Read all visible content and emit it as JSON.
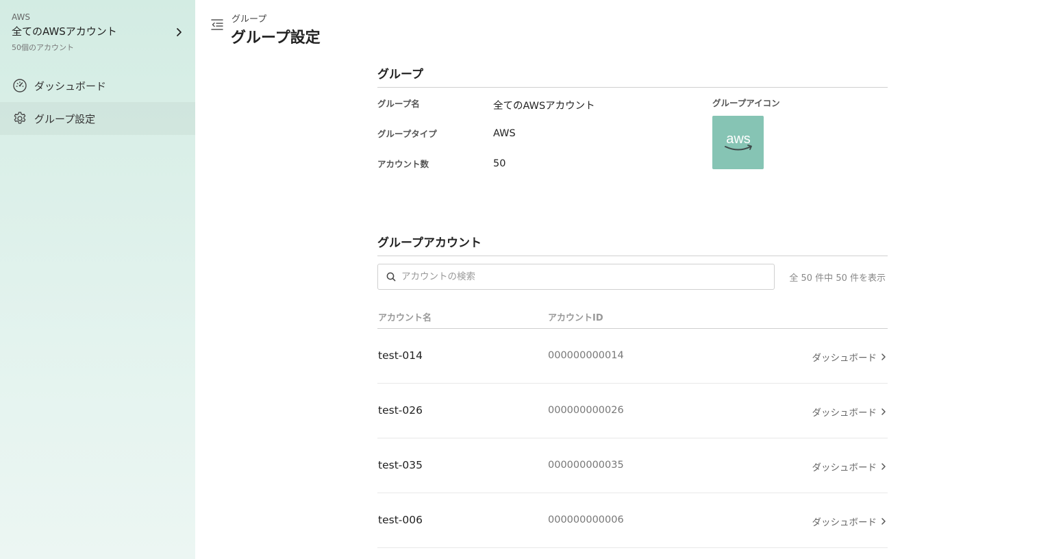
{
  "sidebar": {
    "org": {
      "provider": "AWS",
      "name": "全てのAWSアカウント",
      "count": "50個のアカウント"
    },
    "items": [
      {
        "label": "ダッシュボード",
        "icon": "gauge-icon",
        "active": false
      },
      {
        "label": "グループ設定",
        "icon": "gear-icon",
        "active": true
      }
    ]
  },
  "header": {
    "breadcrumb": "グループ",
    "title": "グループ設定"
  },
  "group": {
    "section_title": "グループ",
    "name_label": "グループ名",
    "name_value": "全てのAWSアカウント",
    "type_label": "グループタイプ",
    "type_value": "AWS",
    "count_label": "アカウント数",
    "count_value": "50",
    "icon_label": "グループアイコン",
    "icon_text": "aws",
    "icon_color": "#86c4b4"
  },
  "accounts": {
    "section_title": "グループアカウント",
    "search_placeholder": "アカウントの検索",
    "search_value": "",
    "result_count": "全 50 件中 50 件を表示",
    "columns": {
      "name": "アカウント名",
      "id": "アカウントID"
    },
    "rows": [
      {
        "name": "test-014",
        "id": "000000000014",
        "link": "ダッシュボード"
      },
      {
        "name": "test-026",
        "id": "000000000026",
        "link": "ダッシュボード"
      },
      {
        "name": "test-035",
        "id": "000000000035",
        "link": "ダッシュボード"
      },
      {
        "name": "test-006",
        "id": "000000000006",
        "link": "ダッシュボード"
      }
    ]
  }
}
